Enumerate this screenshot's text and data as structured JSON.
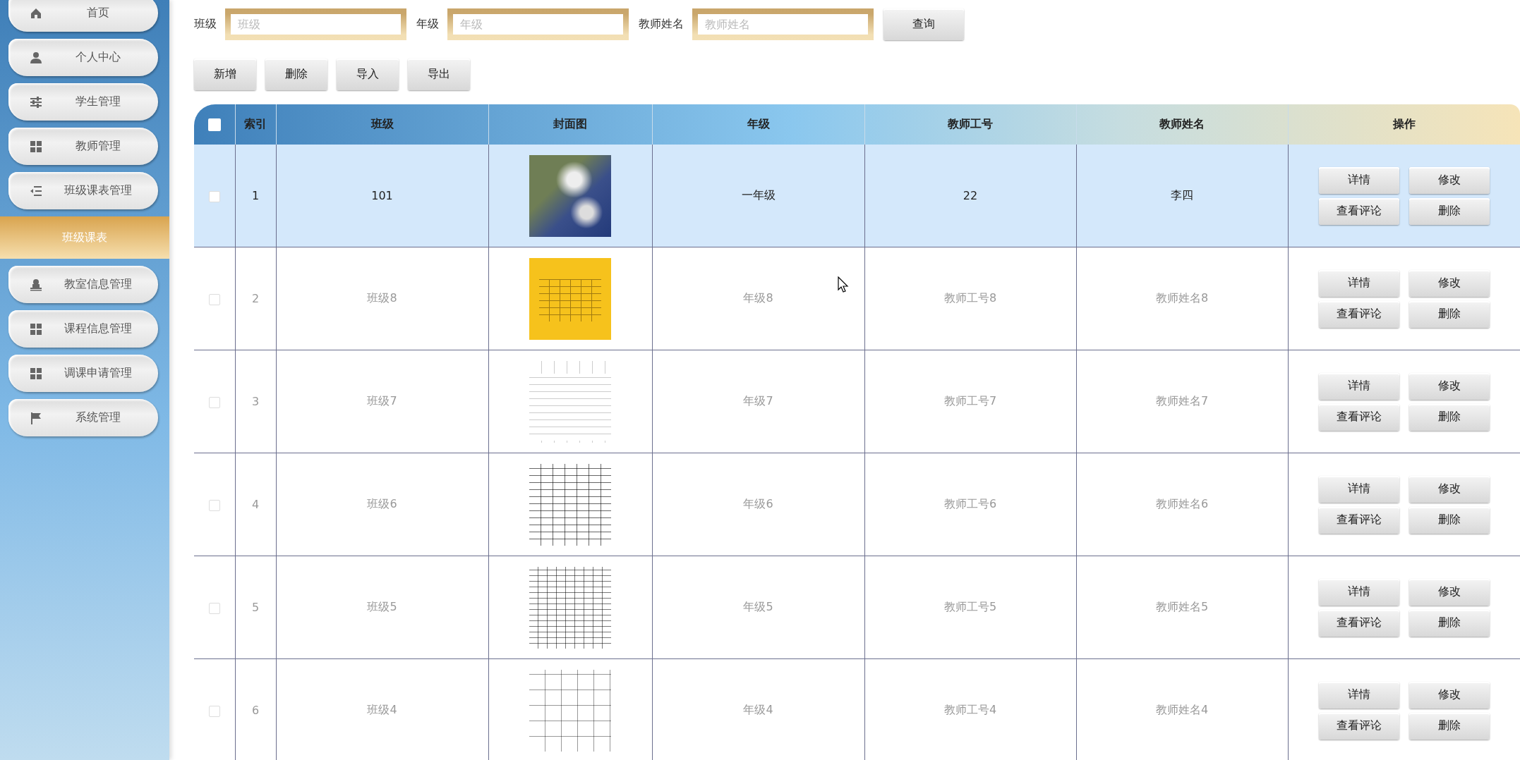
{
  "sidebar": {
    "items": [
      {
        "label": "首页",
        "selected": false
      },
      {
        "label": "个人中心",
        "selected": false
      },
      {
        "label": "学生管理",
        "selected": false
      },
      {
        "label": "教师管理",
        "selected": false
      },
      {
        "label": "班级课表管理",
        "selected": false,
        "children": [
          {
            "label": "班级课表",
            "selected": true
          }
        ]
      },
      {
        "label": "教室信息管理",
        "selected": false
      },
      {
        "label": "课程信息管理",
        "selected": false
      },
      {
        "label": "调课申请管理",
        "selected": false
      },
      {
        "label": "系统管理",
        "selected": false
      }
    ]
  },
  "filters": {
    "fields": [
      {
        "label": "班级",
        "placeholder": "班级"
      },
      {
        "label": "年级",
        "placeholder": "年级"
      },
      {
        "label": "教师姓名",
        "placeholder": "教师姓名"
      }
    ],
    "search_button": "查询"
  },
  "toolbar": [
    "新增",
    "删除",
    "导入",
    "导出"
  ],
  "table": {
    "select_all_checked": false,
    "columns": [
      "索引",
      "班级",
      "封面图",
      "年级",
      "教师工号",
      "教师姓名",
      "操作"
    ],
    "rows": [
      {
        "index": "1",
        "class": "101",
        "grade": "一年级",
        "teacher_id": "22",
        "teacher_name": "李四",
        "selected": true,
        "checked": false,
        "actions": [
          "详情",
          "修改",
          "查看评论",
          "删除"
        ]
      },
      {
        "index": "2",
        "class": "班级8",
        "grade": "年级8",
        "teacher_id": "教师工号8",
        "teacher_name": "教师姓名8",
        "selected": false,
        "checked": false,
        "actions": [
          "详情",
          "修改",
          "查看评论",
          "删除"
        ]
      },
      {
        "index": "3",
        "class": "班级7",
        "grade": "年级7",
        "teacher_id": "教师工号7",
        "teacher_name": "教师姓名7",
        "selected": false,
        "checked": false,
        "actions": [
          "详情",
          "修改",
          "查看评论",
          "删除"
        ]
      },
      {
        "index": "4",
        "class": "班级6",
        "grade": "年级6",
        "teacher_id": "教师工号6",
        "teacher_name": "教师姓名6",
        "selected": false,
        "checked": false,
        "actions": [
          "详情",
          "修改",
          "查看评论",
          "删除"
        ]
      },
      {
        "index": "5",
        "class": "班级5",
        "grade": "年级5",
        "teacher_id": "教师工号5",
        "teacher_name": "教师姓名5",
        "selected": false,
        "checked": false,
        "actions": [
          "详情",
          "修改",
          "查看评论",
          "删除"
        ]
      },
      {
        "index": "6",
        "class": "班级4",
        "grade": "年级4",
        "teacher_id": "教师工号4",
        "teacher_name": "教师姓名4",
        "selected": false,
        "checked": false,
        "actions": [
          "详情",
          "修改",
          "查看评论",
          "删除"
        ]
      }
    ]
  }
}
